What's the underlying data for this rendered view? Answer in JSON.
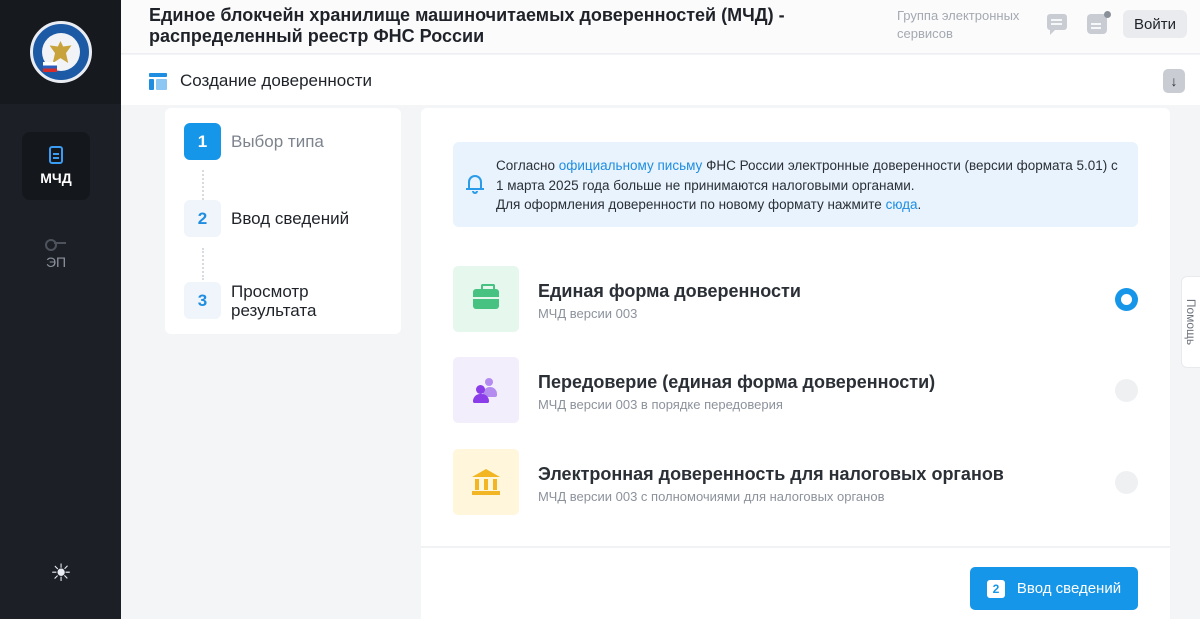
{
  "sidebar": {
    "nav": [
      {
        "label": "МЧД",
        "icon": "document-icon",
        "active": true
      },
      {
        "label": "ЭП",
        "icon": "key-icon",
        "active": false
      }
    ],
    "theme_icon": "sun-icon"
  },
  "header": {
    "site_title": "Единое блокчейн хранилище машиночитаемых доверенностей (МЧД) - распределенный реестр ФНС России",
    "group_link": "Группа электронных сервисов",
    "login_label": "Войти"
  },
  "subheader": {
    "page_title": "Создание доверенности",
    "download_glyph": "↓"
  },
  "steps": [
    {
      "num": "1",
      "label": "Выбор типа",
      "state": "active"
    },
    {
      "num": "2",
      "label": "Ввод сведений",
      "state": "pending"
    },
    {
      "num": "3",
      "label": "Просмотр результата",
      "state": "pending"
    }
  ],
  "notice": {
    "part1": "Согласно ",
    "link1": "официальному письму",
    "part2": " ФНС России электронные доверенности (версии формата 5.01) с 1 марта 2025 года больше не принимаются налоговыми органами.",
    "part3": "Для оформления доверенности по новому формату нажмите ",
    "link2": "сюда",
    "part4": "."
  },
  "options": [
    {
      "title": "Единая форма доверенности",
      "subtitle": "МЧД версии 003",
      "icon": "briefcase-icon",
      "bg": "#e6f7ee",
      "selected": true
    },
    {
      "title": "Передоверие (единая форма доверенности)",
      "subtitle": "МЧД версии 003 в порядке передоверия",
      "icon": "people-icon",
      "bg": "#f3eefc",
      "selected": false
    },
    {
      "title": "Электронная доверенность для налоговых органов",
      "subtitle": "МЧД версии 003 с полномочиями для налоговых органов",
      "icon": "bank-icon",
      "bg": "#fff6dc",
      "selected": false
    }
  ],
  "next_button": {
    "badge": "2",
    "label": "Ввод сведений"
  },
  "help_tab": "Помощь",
  "colors": {
    "accent": "#1696e8",
    "sidebar": "#1c2026"
  }
}
